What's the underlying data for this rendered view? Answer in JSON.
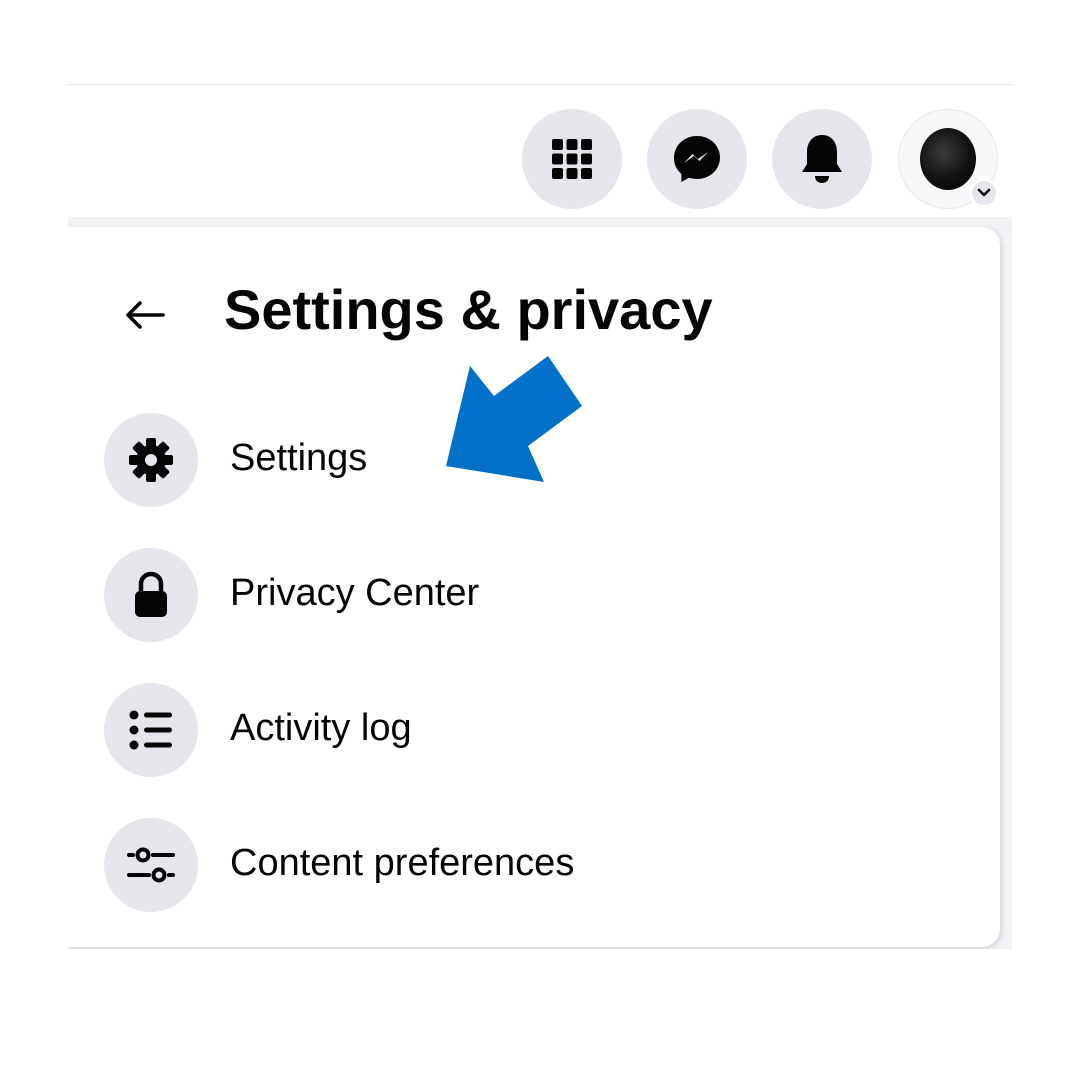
{
  "header": {
    "menu_icon": "grid-menu-icon",
    "messenger_icon": "messenger-icon",
    "notifications_icon": "bell-icon",
    "account_icon": "avatar"
  },
  "panel": {
    "back_icon": "arrow-left-icon",
    "title": "Settings & privacy",
    "items": [
      {
        "label": "Settings",
        "icon": "gear-icon"
      },
      {
        "label": "Privacy Center",
        "icon": "lock-icon"
      },
      {
        "label": "Activity log",
        "icon": "list-icon"
      },
      {
        "label": "Content preferences",
        "icon": "sliders-icon"
      }
    ]
  },
  "annotation": {
    "icon": "pointer-arrow-icon",
    "color": "#0070c9"
  },
  "colors": {
    "icon_circle": "#e4e6eb",
    "text": "#050505",
    "background": "#f0f2f5"
  }
}
